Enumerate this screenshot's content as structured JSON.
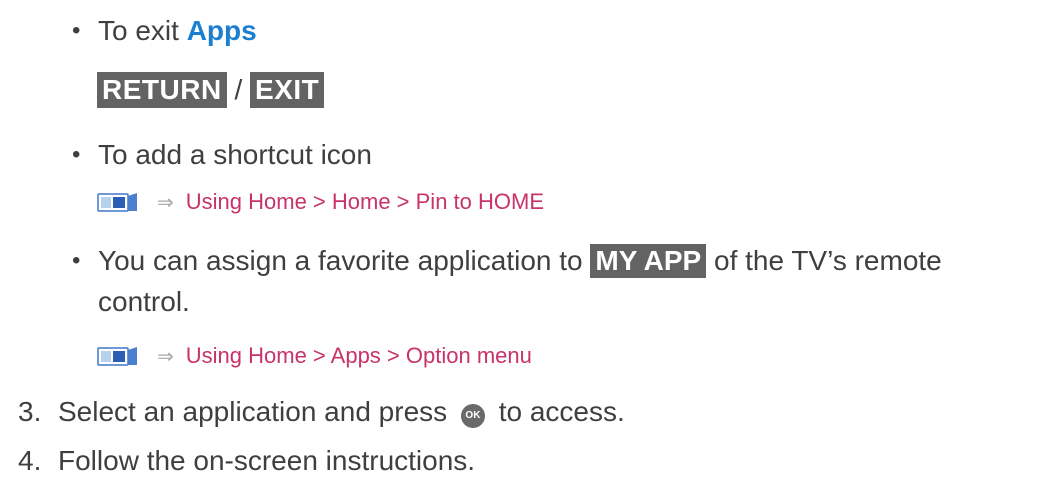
{
  "item_exit": {
    "bullet": "•",
    "text": "To exit ",
    "highlight": "Apps"
  },
  "exit_keys": {
    "key1": "RETURN",
    "separator": " / ",
    "key2": "EXIT"
  },
  "item_shortcut": {
    "bullet": "•",
    "text": "To add a shortcut icon"
  },
  "ref_shortcut": {
    "icon": "manual-book-icon",
    "arrow": "⇒",
    "link": "Using Home > Home > Pin to HOME"
  },
  "item_assign": {
    "bullet": "•",
    "text_before": "You can assign a favorite application to ",
    "key": "MY APP",
    "text_after": " of the TV’s remote",
    "text_line2": "control."
  },
  "ref_assign": {
    "icon": "manual-book-icon",
    "arrow": "⇒",
    "link": "Using Home > Apps > Option menu"
  },
  "step3": {
    "number": "3.",
    "text_before": "Select an application and press ",
    "ok_icon": "OK",
    "text_after": " to access."
  },
  "step4": {
    "number": "4.",
    "text": "Follow the on-screen instructions."
  },
  "colors": {
    "accent": "#1a7fd0",
    "link": "#c8336a",
    "key_bg": "#636363",
    "text": "#3f3f3f"
  }
}
